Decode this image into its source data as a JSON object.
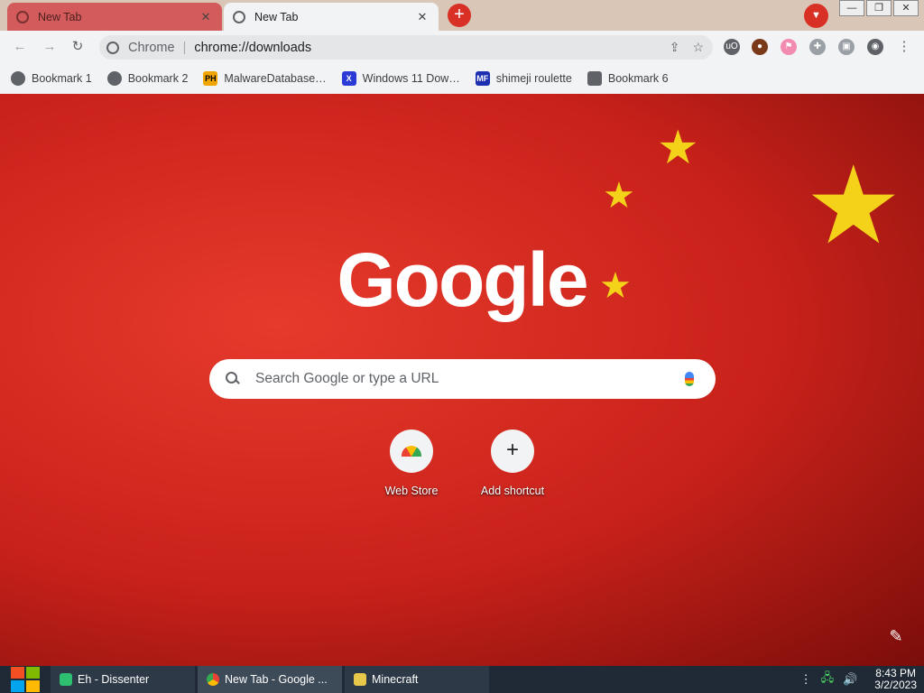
{
  "tabs": [
    {
      "title": "New Tab",
      "close": "✕"
    },
    {
      "title": "New Tab",
      "close": "✕"
    }
  ],
  "newtab_glyph": "+",
  "tabsearch_glyph": "▼",
  "window_buttons": [
    "—",
    "❐",
    "✕"
  ],
  "nav": {
    "back": "←",
    "forward": "→",
    "reload": "↻"
  },
  "omnibox": {
    "chip": "Chrome",
    "sep": "|",
    "url": "chrome://downloads"
  },
  "omni_actions": {
    "share": "⇪",
    "star": "☆"
  },
  "extensions": {
    "a": "uO",
    "b": "●",
    "c": "⚑",
    "d": "✚",
    "e": "▣",
    "f": "◉",
    "g": "⋮"
  },
  "bookmarks": [
    {
      "label": "Bookmark 1",
      "icon": "",
      "color": "#5f6368"
    },
    {
      "label": "Bookmark 2",
      "icon": "",
      "color": "#5f6368"
    },
    {
      "label": "MalwareDatabase…",
      "icon": "PH",
      "color": "#f0a500"
    },
    {
      "label": "Windows 11 Dow…",
      "icon": "X",
      "color": "#2b3bd6"
    },
    {
      "label": "shimeji roulette",
      "icon": "MF",
      "color": "#1b2fb0"
    },
    {
      "label": "Bookmark 6",
      "icon": "",
      "color": "#5f6368"
    }
  ],
  "ntp": {
    "logo": "Google",
    "search_placeholder": "Search Google or type a URL",
    "shortcuts": [
      {
        "label": "Web Store"
      },
      {
        "label": "Add shortcut",
        "glyph": "+"
      }
    ],
    "edit_glyph": "✎"
  },
  "taskbar": {
    "tasks": [
      {
        "label": "Eh - Dissenter",
        "color": "#2fbf71"
      },
      {
        "label": "New Tab - Google ...",
        "color": "#ea4335"
      },
      {
        "label": "Minecraft",
        "color": "#e8c84a"
      }
    ],
    "tray": {
      "more": "⋮",
      "network": "🖧",
      "volume": "🔊"
    },
    "time": "8:43 PM",
    "date": "3/2/2023"
  }
}
